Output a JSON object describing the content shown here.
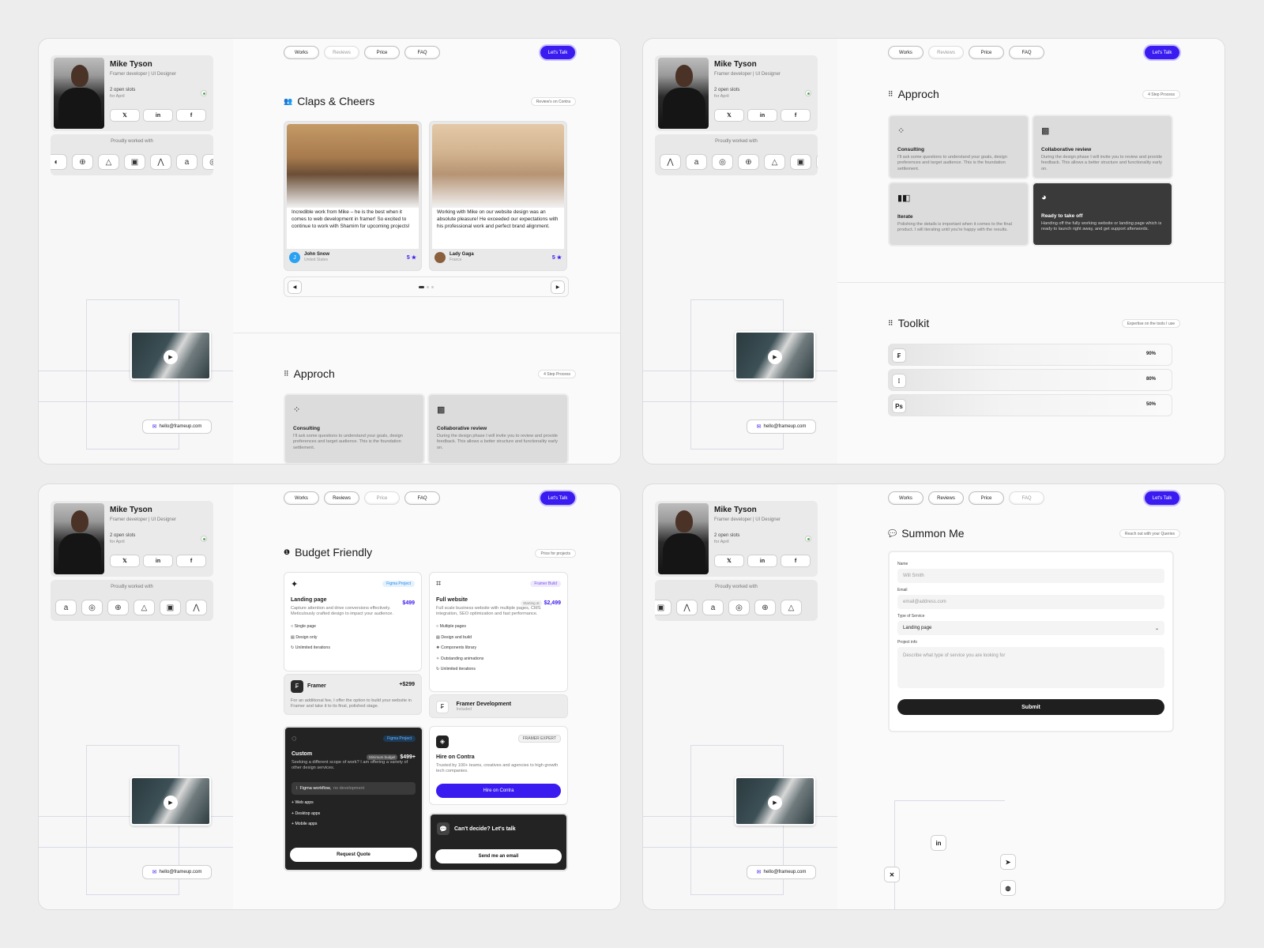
{
  "profile": {
    "name": "Mike Tyson",
    "role": "Framer developer | UI Designer",
    "slots": "2 open slots",
    "slots_sub": "for April",
    "socials": [
      "𝕏",
      "in",
      "f"
    ],
    "worked_with": "Proudly worked with",
    "email": "hello@frameup.com"
  },
  "nav": {
    "works": "Works",
    "reviews": "Reviews",
    "price": "Price",
    "faq": "FAQ",
    "talk": "Let's Talk"
  },
  "reviews": {
    "title": "Claps & Cheers",
    "tag": "Review's on Contra",
    "items": [
      {
        "text": "Incredible work from Mike – he is the best when it comes to web development in framer! So excited to continue to work with Shamim for upcoming projects!",
        "name": "John Snow",
        "location": "United States",
        "avatar": "J",
        "rating": "5 ★"
      },
      {
        "text": "Working with Mike on our website design was an absolute pleasure! He exceeded our expectations with his professional work and perfect brand alignment.",
        "name": "Lady Gaga",
        "location": "France",
        "avatar": "",
        "rating": "5 ★"
      }
    ]
  },
  "approach": {
    "title": "Approch",
    "tag": "4 Step Process",
    "steps": [
      {
        "title": "Consulting",
        "desc": "I'll ask some questions to understand your goals, design preferences and target audience. This is the foundation settlement."
      },
      {
        "title": "Collaborative review",
        "desc": "During the design phase I will invite you to review and provide feedback. This allows a better structure and functionality early on."
      },
      {
        "title": "Iterate",
        "desc": "Polishing the details is important when it comes to the final product. I will iterating until you're happy with the results."
      },
      {
        "title": "Ready to take off",
        "desc": "Handing off the fully working website or landing page which is ready to launch right away, and get support afterwords."
      }
    ]
  },
  "toolkit": {
    "title": "Toolkit",
    "tag": "Expertise on the tools I use",
    "tools": [
      {
        "icon": "framer-icon",
        "glyph": "₣",
        "value": "90%"
      },
      {
        "icon": "figma-icon",
        "glyph": "⁞",
        "value": "80%"
      },
      {
        "icon": "photoshop-icon",
        "glyph": "Ps",
        "value": "50%"
      }
    ]
  },
  "pricing": {
    "title": "Budget Friendly",
    "tag": "Price for projects",
    "landing": {
      "tag": "Figma Project",
      "title": "Landing page",
      "price": "$499",
      "desc": "Capture attention and drive conversions effectively. Meticulously crafted design to impact your audience.",
      "features": [
        "Single page",
        "Design only",
        "Unlimited iterations"
      ]
    },
    "full": {
      "tag": "Framer Build",
      "title": "Full website",
      "starting": "Starting at",
      "price": "$2,499",
      "desc": "Full scale business website with multiple pages, CMS integration, SEO optimization and fast performance.",
      "features": [
        "Multiple pages",
        "Design and build",
        "Components library",
        "Outstanding animations",
        "Unlimited iterations"
      ]
    },
    "framer_addon": {
      "title": "Framer",
      "price": "+$299",
      "desc": "For an additional fee, I offer the option to build your website in Framer and take it to its final, polished stage."
    },
    "framer_dev": {
      "title": "Framer Development",
      "sub": "Included"
    },
    "custom": {
      "tag": "Figma Project",
      "title": "Custom",
      "min": "Minimum budget",
      "price": "$499+",
      "desc": "Seeking a different scope of work? I am offering a variety of other design services.",
      "workflow": "Figma workflow,",
      "workflow_sub": "no development",
      "features": [
        "Web apps",
        "Desktop apps",
        "Mobile apps"
      ],
      "button": "Request Quote"
    },
    "contra": {
      "tag": "FRAMER EXPERT",
      "title": "Hire on Contra",
      "desc": "Trusted by 100+ teams, creatives and agencies to high growth tech companies.",
      "button": "Hire on Contra"
    },
    "decide": {
      "title": "Can't decide? Let's talk",
      "button": "Send me an email"
    }
  },
  "contact": {
    "title": "Summon Me",
    "tag": "Reach out with your Queries",
    "name_label": "Name",
    "name_placeholder": "Will Smith",
    "email_label": "Email",
    "email_placeholder": "email@address.com",
    "service_label": "Type of Service",
    "service_value": "Landing page",
    "info_label": "Project info",
    "info_placeholder": "Describe what type of service you are looking for",
    "submit": "Submit"
  }
}
